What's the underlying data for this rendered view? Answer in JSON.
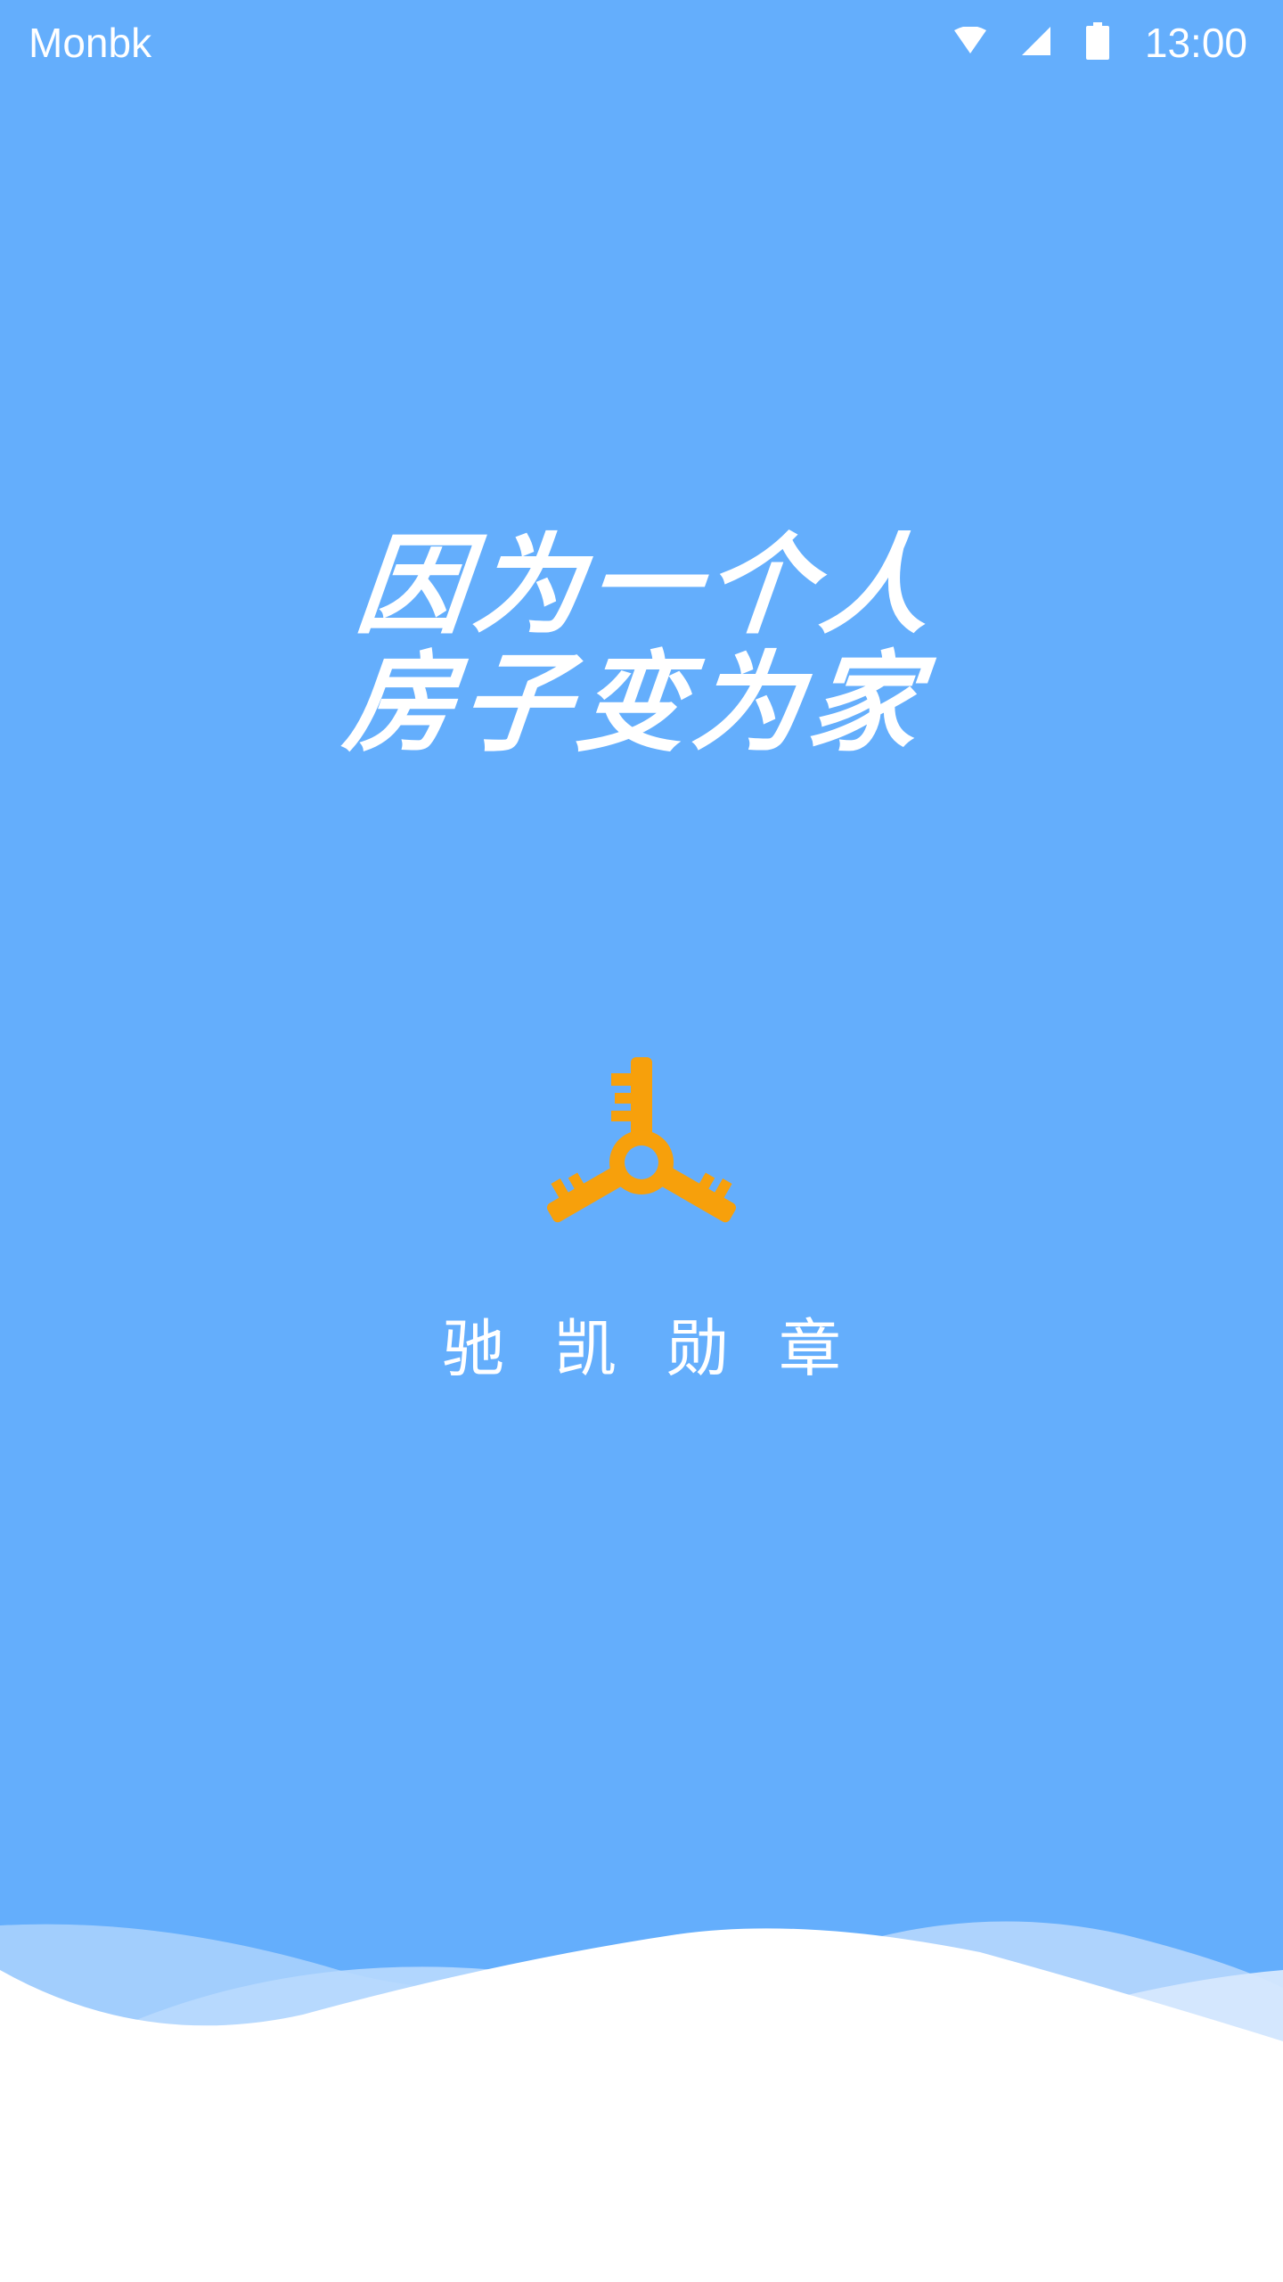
{
  "status_bar": {
    "carrier": "Monbk",
    "time": "13:00",
    "icons": [
      "wifi-icon",
      "cell-signal-icon",
      "battery-icon"
    ]
  },
  "slogan": {
    "line1": "因为一个人",
    "line2": "房子变为家"
  },
  "brand": {
    "name": "驰凯勋章",
    "logo_icon": "three-keys-icon"
  },
  "colors": {
    "background": "#64aefc",
    "logo": "#f7a00b",
    "text": "#ffffff",
    "footer": "#ffffff"
  }
}
